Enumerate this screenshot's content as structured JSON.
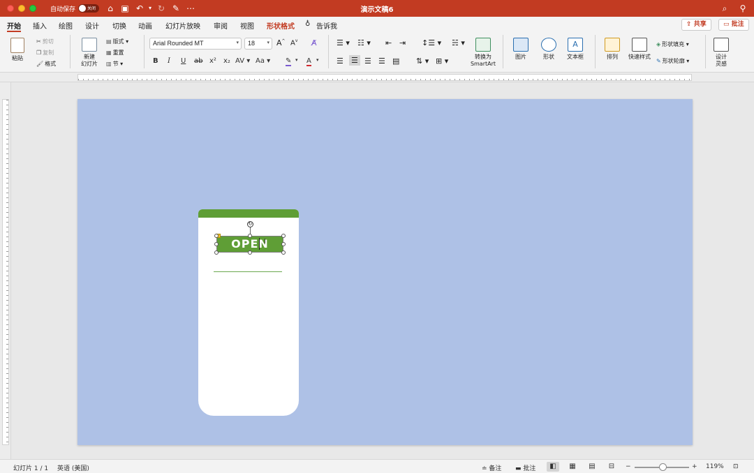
{
  "titlebar": {
    "autosave_label": "自动保存",
    "autosave_state": "关闭",
    "doc_title": "演示文稿6"
  },
  "tabs": [
    {
      "label": "开始"
    },
    {
      "label": "插入"
    },
    {
      "label": "绘图"
    },
    {
      "label": "设计"
    },
    {
      "label": "切换"
    },
    {
      "label": "动画"
    },
    {
      "label": "幻灯片放映"
    },
    {
      "label": "审阅"
    },
    {
      "label": "视图"
    },
    {
      "label": "形状格式"
    },
    {
      "label": "告诉我"
    }
  ],
  "topright": {
    "share": "共享",
    "comment": "批注"
  },
  "ribbon": {
    "paste": "粘贴",
    "cut": "剪切",
    "copy": "复制",
    "format_painter": "格式",
    "new_slide_line1": "新建",
    "new_slide_line2": "幻灯片",
    "layout": "版式",
    "reset": "重置",
    "section": "节",
    "font_name": "Arial Rounded MT",
    "font_size": "18",
    "convert_line1": "转换为",
    "convert_line2": "SmartArt",
    "picture": "图片",
    "shape": "形状",
    "textbox": "文本框",
    "arrange": "排列",
    "quick_styles": "快速样式",
    "shape_fill": "形状填充",
    "shape_outline": "形状轮廓",
    "designer_line1": "设计",
    "designer_line2": "灵感"
  },
  "slide": {
    "open_text": "OPEN"
  },
  "status": {
    "slide_count": "幻灯片 1 / 1",
    "language": "英语 (美国)",
    "notes": "备注",
    "comments": "批注",
    "zoom": "119%"
  },
  "colors": {
    "title_bar": "#c23b22",
    "slide_bg": "#aec1e6",
    "card_green": "#5f9e36"
  }
}
